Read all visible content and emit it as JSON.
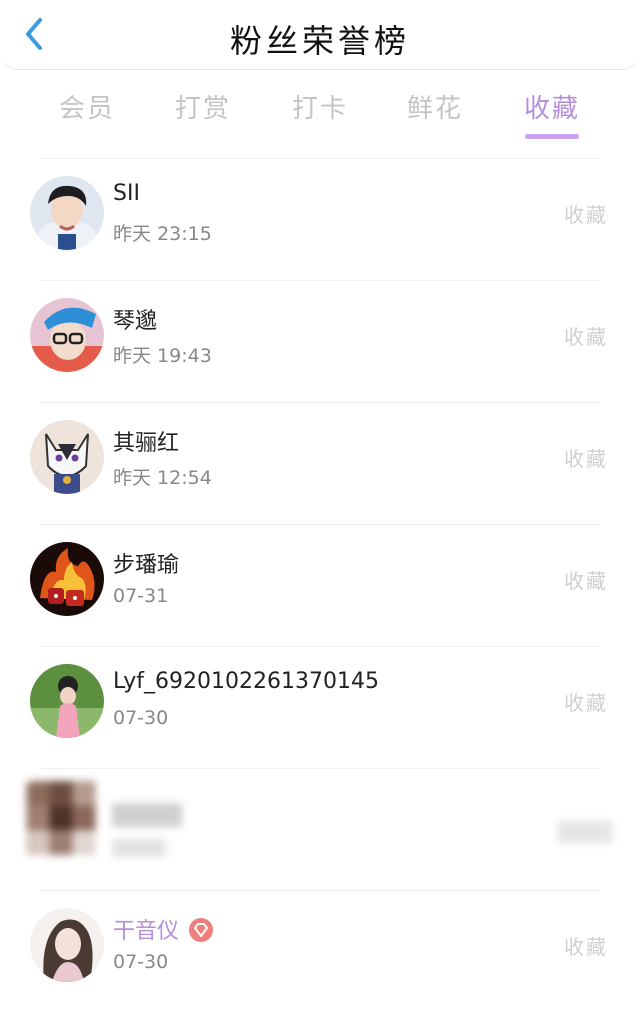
{
  "header": {
    "title": "粉丝荣誉榜",
    "back_icon": "chevron-left-icon"
  },
  "tabs": [
    {
      "label": "会员",
      "active": false
    },
    {
      "label": "打赏",
      "active": false
    },
    {
      "label": "打卡",
      "active": false
    },
    {
      "label": "鲜花",
      "active": false
    },
    {
      "label": "收藏",
      "active": true
    }
  ],
  "colors": {
    "accent": "#b48fda",
    "back_arrow": "#3b9be0",
    "vip_badge": "#ee7e7e"
  },
  "fans": [
    {
      "name": "SII",
      "time": "昨天 23:15",
      "action": "收藏"
    },
    {
      "name": "琴邈",
      "time": "昨天 19:43",
      "action": "收藏"
    },
    {
      "name": "其骊红",
      "time": "昨天 12:54",
      "action": "收藏"
    },
    {
      "name": "步璠瑜",
      "time": "07-31",
      "action": "收藏"
    },
    {
      "name": "Lyf_6920102261370145",
      "time": "07-30",
      "action": "收藏"
    },
    {
      "name": "",
      "time": "",
      "action": "",
      "obscured": true
    },
    {
      "name": "干音仪",
      "time": "07-30",
      "action": "收藏",
      "vip": true
    }
  ]
}
